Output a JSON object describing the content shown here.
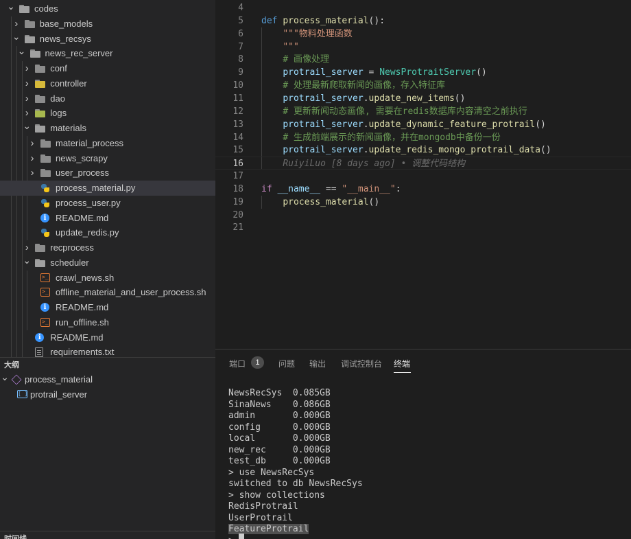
{
  "explorer": {
    "rows": [
      {
        "label": "codes",
        "type": "folder",
        "open": true,
        "depth": 0
      },
      {
        "label": "base_models",
        "type": "folder",
        "open": false,
        "depth": 1
      },
      {
        "label": "news_recsys",
        "type": "folder",
        "open": true,
        "depth": 1
      },
      {
        "label": "news_rec_server",
        "type": "folder",
        "open": true,
        "depth": 2
      },
      {
        "label": "conf",
        "type": "folder",
        "open": false,
        "depth": 3
      },
      {
        "label": "controller",
        "type": "folder",
        "open": false,
        "depth": 3,
        "icon": "controller-folder-icon"
      },
      {
        "label": "dao",
        "type": "folder",
        "open": false,
        "depth": 3
      },
      {
        "label": "logs",
        "type": "folder",
        "open": false,
        "depth": 3,
        "icon": "logs-folder-icon"
      },
      {
        "label": "materials",
        "type": "folder",
        "open": true,
        "depth": 3
      },
      {
        "label": "material_process",
        "type": "folder",
        "open": false,
        "depth": 4
      },
      {
        "label": "news_scrapy",
        "type": "folder",
        "open": false,
        "depth": 4
      },
      {
        "label": "user_process",
        "type": "folder",
        "open": false,
        "depth": 4
      },
      {
        "label": "process_material.py",
        "type": "python",
        "depth": 4,
        "selected": true
      },
      {
        "label": "process_user.py",
        "type": "python",
        "depth": 4
      },
      {
        "label": "README.md",
        "type": "info",
        "depth": 4
      },
      {
        "label": "update_redis.py",
        "type": "python",
        "depth": 4
      },
      {
        "label": "recprocess",
        "type": "folder",
        "open": false,
        "depth": 3
      },
      {
        "label": "scheduler",
        "type": "folder",
        "open": true,
        "depth": 3
      },
      {
        "label": "crawl_news.sh",
        "type": "shell",
        "depth": 4
      },
      {
        "label": "offline_material_and_user_process.sh",
        "type": "shell",
        "depth": 4
      },
      {
        "label": "README.md",
        "type": "info",
        "depth": 4
      },
      {
        "label": "run_offline.sh",
        "type": "shell",
        "depth": 4
      },
      {
        "label": "README.md",
        "type": "info",
        "depth": 3
      },
      {
        "label": "requirements.txt",
        "type": "text",
        "depth": 3
      }
    ]
  },
  "outline": {
    "header": "大纲",
    "items": [
      {
        "label": "process_material",
        "icon": "module-cube-icon"
      },
      {
        "label": "protrail_server",
        "icon": "variable-icon"
      }
    ]
  },
  "timeline": {
    "header": "时间线"
  },
  "editor": {
    "active_line": 16,
    "lines": [
      {
        "n": 4,
        "tokens": []
      },
      {
        "n": 5,
        "tokens": [
          {
            "t": "def ",
            "c": "kw"
          },
          {
            "t": "process_material",
            "c": "fn"
          },
          {
            "t": "():",
            "c": "op"
          }
        ]
      },
      {
        "n": 6,
        "tokens": [
          {
            "t": "    ",
            "c": "op"
          },
          {
            "t": "\"\"\"物料处理函数",
            "c": "str"
          }
        ]
      },
      {
        "n": 7,
        "tokens": [
          {
            "t": "    ",
            "c": "op"
          },
          {
            "t": "\"\"\"",
            "c": "str"
          }
        ]
      },
      {
        "n": 8,
        "tokens": [
          {
            "t": "    ",
            "c": "op"
          },
          {
            "t": "# 画像处理",
            "c": "cmt"
          }
        ]
      },
      {
        "n": 9,
        "tokens": [
          {
            "t": "    ",
            "c": "op"
          },
          {
            "t": "protrail_server",
            "c": "var"
          },
          {
            "t": " = ",
            "c": "op"
          },
          {
            "t": "NewsProtraitServer",
            "c": "cls"
          },
          {
            "t": "()",
            "c": "op"
          }
        ]
      },
      {
        "n": 10,
        "tokens": [
          {
            "t": "    ",
            "c": "op"
          },
          {
            "t": "# 处理最新爬取新闻的画像，存入特征库",
            "c": "cmt"
          }
        ]
      },
      {
        "n": 11,
        "tokens": [
          {
            "t": "    ",
            "c": "op"
          },
          {
            "t": "protrail_server",
            "c": "var"
          },
          {
            "t": ".",
            "c": "op"
          },
          {
            "t": "update_new_items",
            "c": "fn"
          },
          {
            "t": "()",
            "c": "op"
          }
        ]
      },
      {
        "n": 12,
        "tokens": [
          {
            "t": "    ",
            "c": "op"
          },
          {
            "t": "# 更新新闻动态画像, 需要在redis数据库内容清空之前执行",
            "c": "cmt"
          }
        ]
      },
      {
        "n": 13,
        "tokens": [
          {
            "t": "    ",
            "c": "op"
          },
          {
            "t": "protrail_server",
            "c": "var"
          },
          {
            "t": ".",
            "c": "op"
          },
          {
            "t": "update_dynamic_feature_protrail",
            "c": "fn"
          },
          {
            "t": "()",
            "c": "op"
          }
        ]
      },
      {
        "n": 14,
        "tokens": [
          {
            "t": "    ",
            "c": "op"
          },
          {
            "t": "# 生成前端展示的新闻画像，并在mongodb中备份一份",
            "c": "cmt"
          }
        ]
      },
      {
        "n": 15,
        "tokens": [
          {
            "t": "    ",
            "c": "op"
          },
          {
            "t": "protrail_server",
            "c": "var"
          },
          {
            "t": ".",
            "c": "op"
          },
          {
            "t": "update_redis_mongo_protrail_data",
            "c": "fn"
          },
          {
            "t": "()",
            "c": "op"
          }
        ]
      },
      {
        "n": 16,
        "tokens": [
          {
            "t": "    ",
            "c": "op"
          },
          {
            "t": "RuiyiLuo [8 days ago] • 调整代码结构",
            "c": "blame"
          }
        ]
      },
      {
        "n": 17,
        "tokens": []
      },
      {
        "n": 18,
        "tokens": [
          {
            "t": "if ",
            "c": "kw2"
          },
          {
            "t": "__name__",
            "c": "var"
          },
          {
            "t": " == ",
            "c": "op"
          },
          {
            "t": "\"__main__\"",
            "c": "str"
          },
          {
            "t": ":",
            "c": "op"
          }
        ]
      },
      {
        "n": 19,
        "tokens": [
          {
            "t": "    ",
            "c": "op"
          },
          {
            "t": "process_material",
            "c": "fn"
          },
          {
            "t": "()",
            "c": "op"
          }
        ]
      },
      {
        "n": 20,
        "tokens": []
      },
      {
        "n": 21,
        "tokens": []
      }
    ]
  },
  "panel": {
    "tabs": [
      {
        "label": "端口",
        "badge": "1"
      },
      {
        "label": "问题"
      },
      {
        "label": "输出"
      },
      {
        "label": "调试控制台"
      },
      {
        "label": "终端",
        "active": true
      }
    ],
    "terminal_lines": [
      "NewsRecSys  0.085GB",
      "SinaNews    0.086GB",
      "admin       0.000GB",
      "config      0.000GB",
      "local       0.000GB",
      "new_rec     0.000GB",
      "test_db     0.000GB",
      "> use NewsRecSys",
      "switched to db NewsRecSys",
      "> show collections",
      "RedisProtrail",
      "UserProtrail",
      "FeatureProtrail"
    ],
    "highlighted_line": 12,
    "prompt": "> "
  }
}
